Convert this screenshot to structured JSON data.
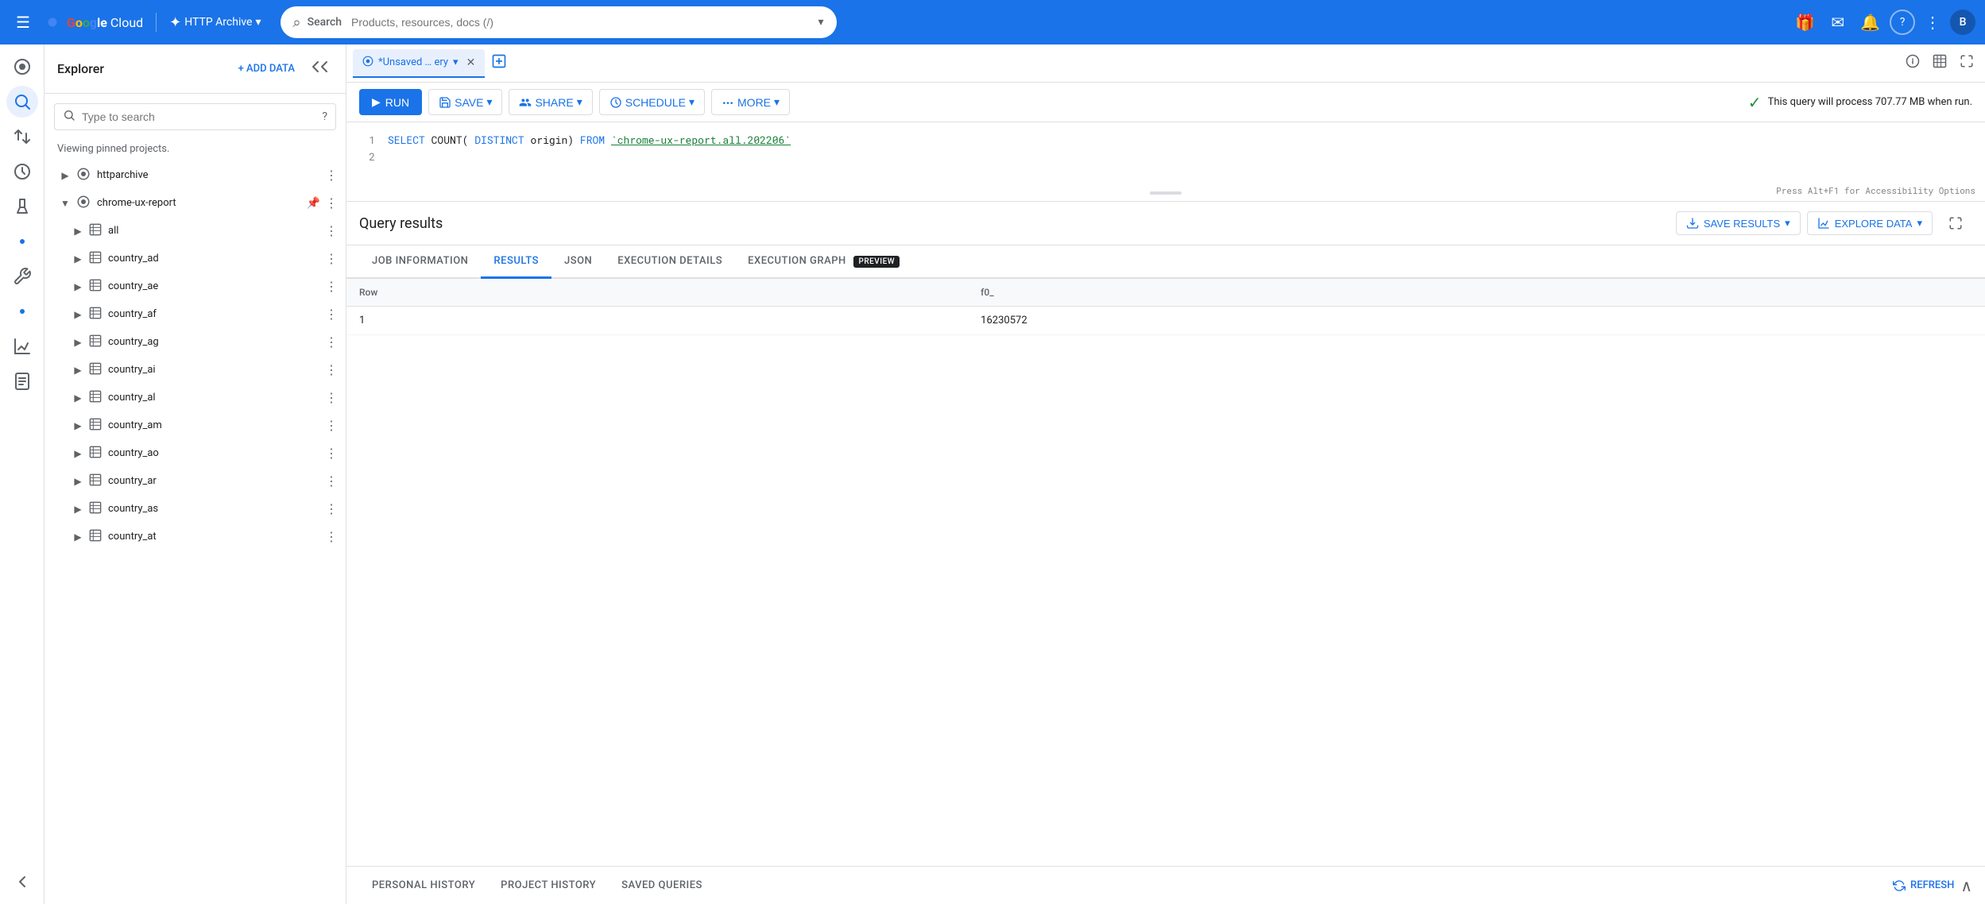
{
  "topnav": {
    "hamburger_icon": "☰",
    "logo": "Google Cloud",
    "project_icon": "✦",
    "project_name": "HTTP Archive",
    "project_dropdown": "▾",
    "search_label": "Search",
    "search_placeholder": "Products, resources, docs (/)",
    "search_chevron": "▾",
    "gift_icon": "🎁",
    "email_icon": "✉",
    "bell_icon": "🔔",
    "help_icon": "?",
    "more_icon": "⋮",
    "avatar_label": "B"
  },
  "rail": {
    "icons": [
      {
        "name": "menu-dot-icon",
        "symbol": "·",
        "active": false
      },
      {
        "name": "search-icon",
        "symbol": "⌕",
        "active": true
      },
      {
        "name": "transfer-icon",
        "symbol": "⇄",
        "active": false
      },
      {
        "name": "history-icon",
        "symbol": "🕐",
        "active": false
      },
      {
        "name": "lab-icon",
        "symbol": "⚗",
        "active": false
      },
      {
        "name": "dot2-icon",
        "symbol": "·",
        "active": false
      },
      {
        "name": "wrench-icon",
        "symbol": "🔧",
        "active": false
      },
      {
        "name": "dot3-icon",
        "symbol": "·",
        "active": false
      },
      {
        "name": "chart-icon",
        "symbol": "📊",
        "active": false
      },
      {
        "name": "doc-icon",
        "symbol": "📋",
        "active": false
      }
    ],
    "collapse_icon": "‹"
  },
  "explorer": {
    "title": "Explorer",
    "add_data_label": "+ ADD DATA",
    "collapse_icon": "⟨",
    "search_placeholder": "Type to search",
    "search_help": "?",
    "info_text": "Viewing pinned projects.",
    "tree": [
      {
        "id": "httparchive",
        "label": "httparchive",
        "level": 0,
        "expanded": false,
        "has_children": true,
        "pinned": false,
        "show_more": true
      },
      {
        "id": "chrome-ux-report",
        "label": "chrome-ux-report",
        "level": 0,
        "expanded": true,
        "has_children": true,
        "pinned": true,
        "show_more": true
      },
      {
        "id": "all",
        "label": "all",
        "level": 1,
        "expanded": false,
        "has_children": true,
        "pinned": false,
        "show_more": true,
        "is_table": true
      },
      {
        "id": "country_ad",
        "label": "country_ad",
        "level": 1,
        "expanded": false,
        "has_children": true,
        "pinned": false,
        "show_more": true,
        "is_table": true
      },
      {
        "id": "country_ae",
        "label": "country_ae",
        "level": 1,
        "expanded": false,
        "has_children": true,
        "pinned": false,
        "show_more": true,
        "is_table": true
      },
      {
        "id": "country_af",
        "label": "country_af",
        "level": 1,
        "expanded": false,
        "has_children": true,
        "pinned": false,
        "show_more": true,
        "is_table": true
      },
      {
        "id": "country_ag",
        "label": "country_ag",
        "level": 1,
        "expanded": false,
        "has_children": true,
        "pinned": false,
        "show_more": true,
        "is_table": true
      },
      {
        "id": "country_ai",
        "label": "country_ai",
        "level": 1,
        "expanded": false,
        "has_children": true,
        "pinned": false,
        "show_more": true,
        "is_table": true
      },
      {
        "id": "country_al",
        "label": "country_al",
        "level": 1,
        "expanded": false,
        "has_children": true,
        "pinned": false,
        "show_more": true,
        "is_table": true
      },
      {
        "id": "country_am",
        "label": "country_am",
        "level": 1,
        "expanded": false,
        "has_children": true,
        "pinned": false,
        "show_more": true,
        "is_table": true
      },
      {
        "id": "country_ao",
        "label": "country_ao",
        "level": 1,
        "expanded": false,
        "has_children": true,
        "pinned": false,
        "show_more": true,
        "is_table": true
      },
      {
        "id": "country_ar",
        "label": "country_ar",
        "level": 1,
        "expanded": false,
        "has_children": true,
        "pinned": false,
        "show_more": true,
        "is_table": true
      },
      {
        "id": "country_as",
        "label": "country_as",
        "level": 1,
        "expanded": false,
        "has_children": true,
        "pinned": false,
        "show_more": true,
        "is_table": true
      },
      {
        "id": "country_at",
        "label": "country_at",
        "level": 1,
        "expanded": false,
        "has_children": true,
        "pinned": false,
        "show_more": true,
        "is_table": true
      }
    ]
  },
  "editor_tabs": {
    "active_tab_label": "*Unsaved … ery",
    "active_tab_icon": "⊙",
    "close_icon": "✕",
    "add_icon": "+",
    "tab_action_info": "ℹ",
    "tab_action_table": "⊞",
    "tab_action_expand": "⛶"
  },
  "toolbar": {
    "run_label": "RUN",
    "run_icon": "▶",
    "save_label": "SAVE",
    "save_icon": "💾",
    "save_chevron": "▾",
    "share_label": "SHARE",
    "share_icon": "👤",
    "share_chevron": "▾",
    "schedule_label": "SCHEDULE",
    "schedule_icon": "🕐",
    "schedule_chevron": "▾",
    "more_label": "MORE",
    "more_icon": "⚙",
    "more_chevron": "▾",
    "status_text": "This query will process 707.77 MB when run.",
    "status_icon": "✓"
  },
  "code_editor": {
    "lines": [
      {
        "num": 1,
        "tokens": [
          {
            "text": "SELECT",
            "type": "keyword"
          },
          {
            "text": " COUNT(",
            "type": "func"
          },
          {
            "text": "DISTINCT",
            "type": "keyword"
          },
          {
            "text": " origin) ",
            "type": "plain"
          },
          {
            "text": "FROM",
            "type": "keyword"
          },
          {
            "text": " `chrome-ux-report.all.202206`",
            "type": "string"
          }
        ]
      },
      {
        "num": 2,
        "tokens": []
      }
    ],
    "accessibility_hint": "Press Alt+F1 for Accessibility Options"
  },
  "results": {
    "title": "Query results",
    "save_results_label": "SAVE RESULTS",
    "save_results_icon": "⬇",
    "explore_data_label": "EXPLORE DATA",
    "explore_data_icon": "📊",
    "expand_icon": "⇅",
    "tabs": [
      {
        "label": "JOB INFORMATION",
        "active": false
      },
      {
        "label": "RESULTS",
        "active": true
      },
      {
        "label": "JSON",
        "active": false
      },
      {
        "label": "EXECUTION DETAILS",
        "active": false
      },
      {
        "label": "EXECUTION GRAPH",
        "active": false,
        "badge": "PREVIEW"
      }
    ],
    "table": {
      "columns": [
        "Row",
        "f0_"
      ],
      "rows": [
        [
          "1",
          "16230572"
        ]
      ]
    }
  },
  "history_bar": {
    "tabs": [
      {
        "label": "PERSONAL HISTORY"
      },
      {
        "label": "PROJECT HISTORY"
      },
      {
        "label": "SAVED QUERIES"
      }
    ],
    "refresh_label": "REFRESH",
    "refresh_icon": "↻",
    "collapse_icon": "∧"
  }
}
